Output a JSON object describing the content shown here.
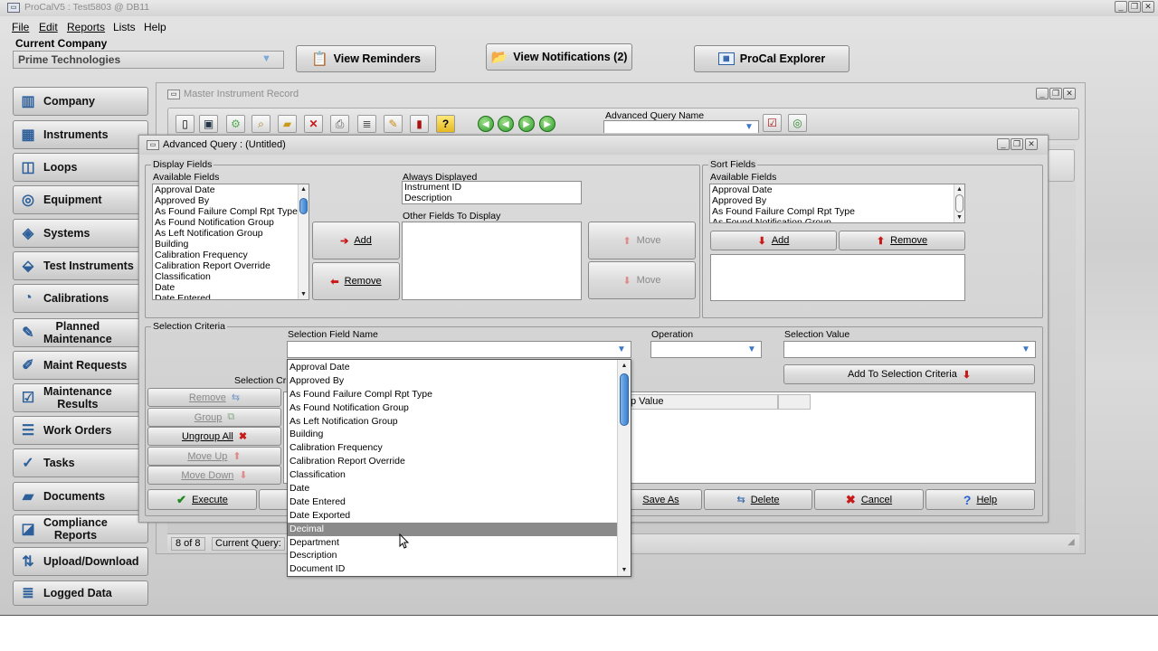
{
  "app": {
    "title": "ProCalV5 : Test5803 @ DB11",
    "menu": [
      "File",
      "Edit",
      "Reports",
      "Lists",
      "Help"
    ],
    "current_company_label": "Current Company",
    "company_value": "Prime Technologies",
    "view_reminders": "View Reminders",
    "view_notifications": "View Notifications (2)",
    "procal_explorer": "ProCal Explorer"
  },
  "sidebar": {
    "items": [
      {
        "label": "Company",
        "icon": "building-icon"
      },
      {
        "label": "Instruments",
        "icon": "grid-icon"
      },
      {
        "label": "Loops",
        "icon": "loop-icon"
      },
      {
        "label": "Equipment",
        "icon": "equipment-icon"
      },
      {
        "label": "Systems",
        "icon": "systems-icon"
      },
      {
        "label": "Test Instruments",
        "icon": "test-instrument-icon"
      },
      {
        "label": "Calibrations",
        "icon": "gauge-icon"
      },
      {
        "label": "Planned\nMaintenance",
        "icon": "wrench-icon"
      },
      {
        "label": "Maint Requests",
        "icon": "request-icon"
      },
      {
        "label": "Maintenance\nResults",
        "icon": "results-icon"
      },
      {
        "label": "Work Orders",
        "icon": "clipboard-icon"
      },
      {
        "label": "Tasks",
        "icon": "tasks-icon"
      },
      {
        "label": "Documents",
        "icon": "folder-icon"
      },
      {
        "label": "Compliance\nReports",
        "icon": "compliance-icon"
      },
      {
        "label": "Upload/Download",
        "icon": "transfer-icon"
      },
      {
        "label": "Logged Data",
        "icon": "log-icon"
      }
    ]
  },
  "master": {
    "title": "Master Instrument Record",
    "advanced_query_name_label": "Advanced Query Name",
    "status_count": "8 of 8",
    "status_current_query": "Current Query:"
  },
  "aq": {
    "title": "Advanced Query : (Untitled)",
    "display_fields": {
      "group_label": "Display Fields",
      "available_label": "Available Fields",
      "available": [
        "Approval Date",
        "Approved By",
        "As Found Failure Compl Rpt Type",
        "As Found Notification Group",
        "As Left Notification Group",
        "Building",
        "Calibration Frequency",
        "Calibration Report Override",
        "Classification",
        "Date",
        "Date Entered"
      ],
      "always_label": "Always Displayed",
      "always": [
        "Instrument ID",
        "Description"
      ],
      "other_label": "Other Fields To Display",
      "add": "Add",
      "remove": "Remove",
      "move_up": "Move",
      "move_down": "Move"
    },
    "sort_fields": {
      "group_label": "Sort Fields",
      "available_label": "Available Fields",
      "available": [
        "Approval Date",
        "Approved By",
        "As Found Failure Compl Rpt Type",
        "As Found Notification Group"
      ],
      "add": "Add",
      "remove": "Remove"
    },
    "selection": {
      "group_label": "Selection Criteria",
      "field_name_label": "Selection Field Name",
      "operation_label": "Operation",
      "value_label": "Selection Value",
      "criteria_label": "Selection Cri",
      "add_to_criteria": "Add To Selection Criteria",
      "grid_col_value": "p Value",
      "remove": "Remove",
      "group": "Group",
      "ungroup_all": "Ungroup All",
      "move_up": "Move Up",
      "move_down": "Move Down"
    },
    "footer": {
      "execute": "Execute",
      "save_as": "Save As",
      "delete": "Delete",
      "cancel": "Cancel",
      "help": "Help"
    },
    "dropdown_options": [
      "Approval Date",
      "Approved By",
      "As Found Failure Compl Rpt Type",
      "As Found Notification Group",
      "As Left Notification Group",
      "Building",
      "Calibration Frequency",
      "Calibration Report Override",
      "Classification",
      "Date",
      "Date Entered",
      "Date Exported",
      "Decimal",
      "Department",
      "Description",
      "Document ID"
    ],
    "dropdown_selected": "Decimal"
  }
}
